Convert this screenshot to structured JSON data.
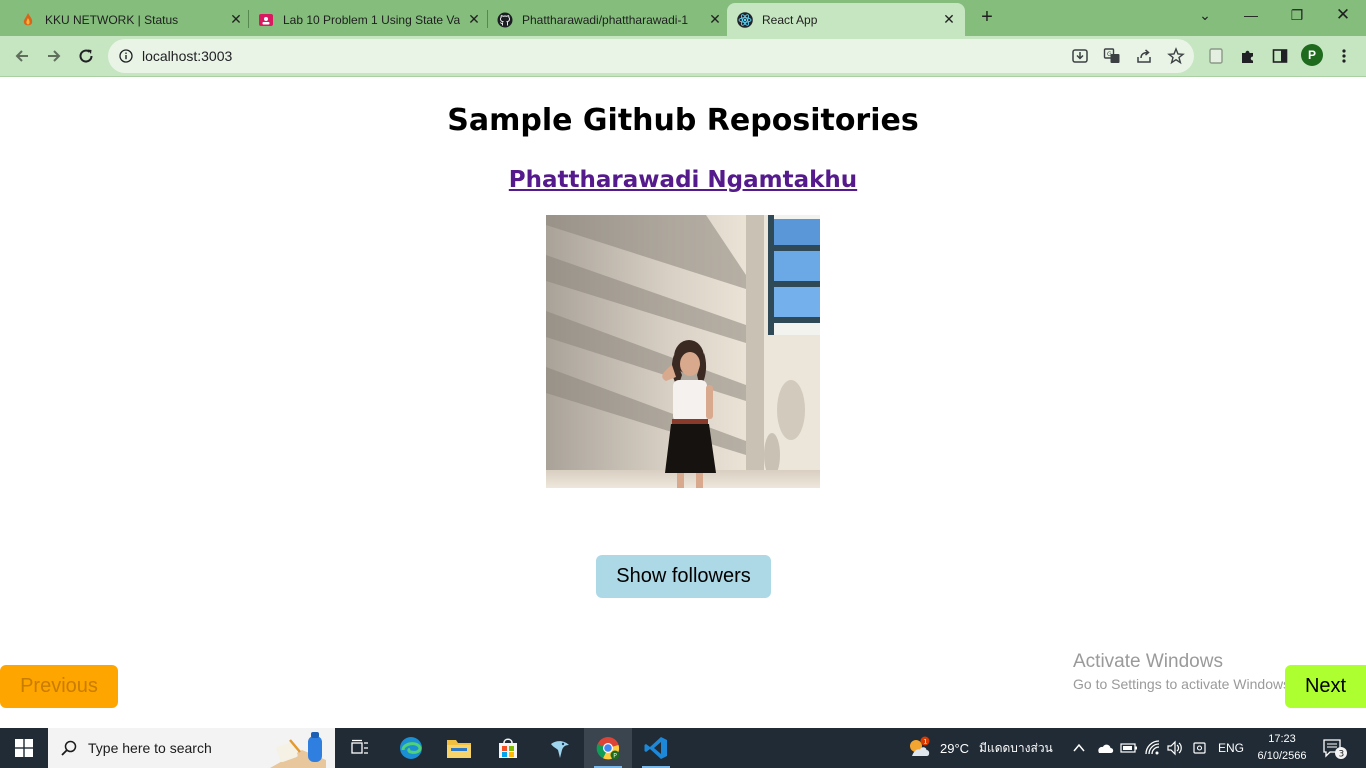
{
  "browser": {
    "tabs": [
      {
        "title": "KKU NETWORK | Status",
        "icon": "kku-flame-icon"
      },
      {
        "title": "Lab 10 Problem 1 Using State Va",
        "icon": "classroom-icon"
      },
      {
        "title": "Phattharawadi/phattharawadi-1",
        "icon": "github-icon"
      },
      {
        "title": "React App",
        "icon": "react-icon",
        "active": true
      }
    ],
    "new_tab_label": "+",
    "url": "localhost:3003",
    "profile_initial": "P"
  },
  "page": {
    "heading": "Sample Github Repositories",
    "user_name": "Phattharawadi Ngamtakhu",
    "show_followers_label": "Show followers",
    "previous_label": "Previous",
    "next_label": "Next"
  },
  "watermark": {
    "line1": "Activate Windows",
    "line2": "Go to Settings to activate Windows."
  },
  "taskbar": {
    "search_placeholder": "Type here to search",
    "weather_temp": "29°C",
    "weather_text": "มีแดดบางส่วน",
    "weather_badge": "1",
    "language": "ENG",
    "time": "17:23",
    "date": "6/10/2566",
    "notification_count": "3"
  },
  "colors": {
    "tabstrip": "#84bd7c",
    "toolbar": "#c6e5c1",
    "link": "#551a8b",
    "show_followers_bg": "#add8e6",
    "previous_bg": "#ffa500",
    "next_bg": "#adff2f",
    "taskbar": "#202b35"
  }
}
